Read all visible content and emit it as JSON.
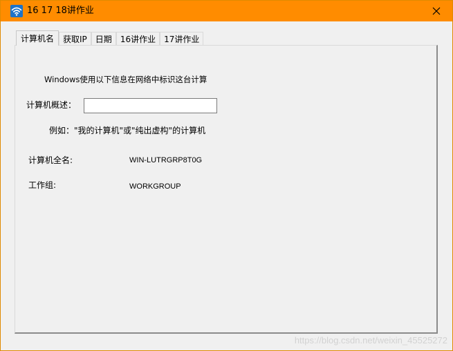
{
  "window": {
    "title": "16 17 18讲作业",
    "close_glyph": "✕"
  },
  "tabs": [
    {
      "label": "计算机名",
      "active": true
    },
    {
      "label": "获取IP",
      "active": false
    },
    {
      "label": "日期",
      "active": false
    },
    {
      "label": "16讲作业",
      "active": false
    },
    {
      "label": "17讲作业",
      "active": false
    }
  ],
  "computer_name_tab": {
    "intro_text": "Windows使用以下信息在网络中标识这台计算",
    "description_label": "计算机概述：",
    "description_value": "",
    "example_text": "例如：\"我的计算机\"或\"纯出虚构\"的计算机",
    "full_name_label": "计算机全名:",
    "full_name_value": "WIN-LUTRGRP8T0G",
    "workgroup_label": "工作组:",
    "workgroup_value": "WORKGROUP"
  },
  "watermark": "https://blog.csdn.net/weixin_45525272",
  "colors": {
    "titlebar": "#ff8c00",
    "client_bg": "#f0f0f0",
    "icon_blue": "#1e73c8"
  },
  "icons": {
    "app": "wifi-icon",
    "close": "close-icon"
  }
}
